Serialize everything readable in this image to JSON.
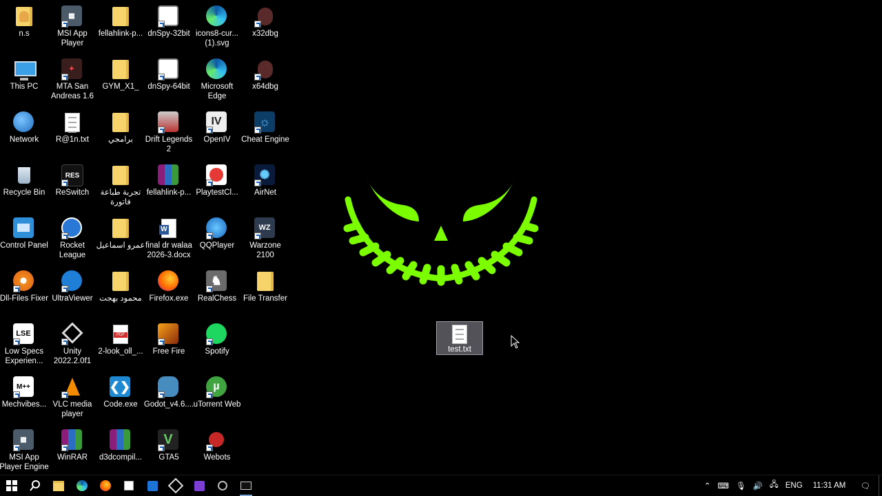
{
  "desktop": {
    "icons": [
      {
        "label": "n.s"
      },
      {
        "label": "MSI App Player"
      },
      {
        "label": "fellahlink-p..."
      },
      {
        "label": "dnSpy-32bit"
      },
      {
        "label": "icons8-cur... (1).svg"
      },
      {
        "label": "x32dbg"
      },
      {
        "label": "This PC"
      },
      {
        "label": "MTA San Andreas 1.6"
      },
      {
        "label": "GYM_X1_"
      },
      {
        "label": "dnSpy-64bit"
      },
      {
        "label": "Microsoft Edge"
      },
      {
        "label": "x64dbg"
      },
      {
        "label": "Network"
      },
      {
        "label": "R@1n.txt"
      },
      {
        "label": "برامجي"
      },
      {
        "label": "Drift Legends 2"
      },
      {
        "label": "OpenIV"
      },
      {
        "label": "Cheat Engine"
      },
      {
        "label": "Recycle Bin"
      },
      {
        "label": "ReSwitch"
      },
      {
        "label": "تجربة طباعة فاتورة"
      },
      {
        "label": "fellahlink-p..."
      },
      {
        "label": "PlaytestCl..."
      },
      {
        "label": "AirNet"
      },
      {
        "label": "Control Panel"
      },
      {
        "label": "Rocket League"
      },
      {
        "label": "عمرو اسماعيل"
      },
      {
        "label": "final dr walaa 2026-3.docx"
      },
      {
        "label": "QQPlayer"
      },
      {
        "label": "Warzone 2100"
      },
      {
        "label": "Dll-Files Fixer"
      },
      {
        "label": "UltraViewer"
      },
      {
        "label": "محمود بهجت"
      },
      {
        "label": "Firefox.exe"
      },
      {
        "label": "RealChess"
      },
      {
        "label": "File Transfer"
      },
      {
        "label": "Low Specs Experien..."
      },
      {
        "label": "Unity 2022.2.0f1"
      },
      {
        "label": "2-look_oll_..."
      },
      {
        "label": "Free Fire"
      },
      {
        "label": "Spotify"
      },
      {
        "label": "Mechvibes..."
      },
      {
        "label": "VLC media player"
      },
      {
        "label": "Code.exe"
      },
      {
        "label": "Godot_v4.6...."
      },
      {
        "label": "uTorrent Web"
      },
      {
        "label": "MSI App Player Engine"
      },
      {
        "label": "WinRAR"
      },
      {
        "label": "d3dcompil..."
      },
      {
        "label": "GTA5"
      },
      {
        "label": "Webots"
      }
    ],
    "selected_file": {
      "label": "test.txt"
    }
  },
  "taskbar": {
    "tray": {
      "language": "ENG",
      "time": "11:31 AM"
    }
  },
  "colors": {
    "wallpaper_accent": "#7CFC00",
    "taskbar": "#000000",
    "selection": "#8c8c96"
  }
}
